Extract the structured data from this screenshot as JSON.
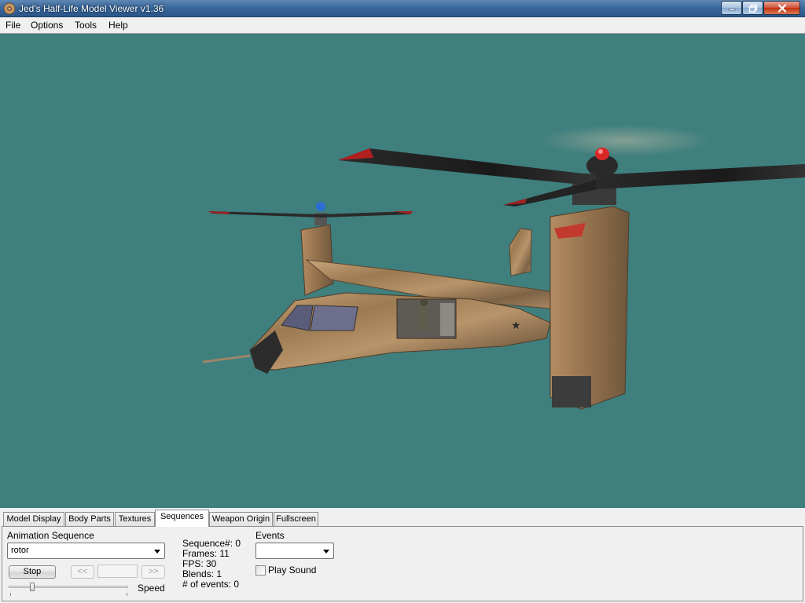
{
  "window": {
    "title": "Jed's Half-Life Model Viewer v1.36"
  },
  "menu": [
    "File",
    "Options",
    "Tools",
    "Help"
  ],
  "viewport": {
    "background_color": "#3f7f7d",
    "model": "tilt-rotor aircraft"
  },
  "tabs": [
    {
      "label": "Model Display",
      "active": false
    },
    {
      "label": "Body Parts",
      "active": false
    },
    {
      "label": "Textures",
      "active": false
    },
    {
      "label": "Sequences",
      "active": true
    },
    {
      "label": "Weapon Origin",
      "active": false
    },
    {
      "label": "Fullscreen",
      "active": false
    }
  ],
  "sequences": {
    "animation_label": "Animation Sequence",
    "selected_sequence": "rotor",
    "stop_label": "Stop",
    "prev_label": "<<",
    "next_label": ">>",
    "speed_label": "Speed",
    "speed_value": 0.2,
    "info": {
      "sequence": "Sequence#: 0",
      "frames": "Frames: 11",
      "fps": "FPS: 30",
      "blends": "Blends: 1",
      "events": "# of events: 0"
    },
    "events_label": "Events",
    "events_selected": "",
    "play_sound_label": "Play Sound",
    "play_sound_checked": false
  }
}
